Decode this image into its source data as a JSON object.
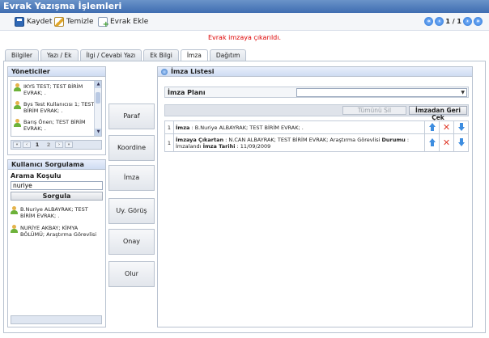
{
  "app": {
    "title": "Evrak Yazışma İşlemleri"
  },
  "toolbar": {
    "save_label": "Kaydet",
    "clear_label": "Temizle",
    "add_label": "Evrak Ekle",
    "page_indicator": "1 / 1"
  },
  "message": "Evrak imzaya çıkarıldı.",
  "tabs": [
    {
      "label": "Bilgiler"
    },
    {
      "label": "Yazı / Ek"
    },
    {
      "label": "İlgi / Cevabi Yazı"
    },
    {
      "label": "Ek Bilgi"
    },
    {
      "label": "İmza"
    },
    {
      "label": "Dağıtım"
    }
  ],
  "active_tab": "İmza",
  "managers": {
    "title": "Yöneticiler",
    "items": [
      {
        "label": "IKYS TEST; TEST BİRİM EVRAK; ."
      },
      {
        "label": "Bys Test Kullanıcısı 1; TEST BİRİM EVRAK; ."
      },
      {
        "label": "Barış Önen; TEST BİRİM EVRAK; ."
      }
    ],
    "pager": {
      "current": "1",
      "next": "2"
    }
  },
  "user_search": {
    "title": "Kullanıcı Sorgulama",
    "label": "Arama Koşulu",
    "value": "nuriye",
    "button": "Sorgula",
    "results": [
      {
        "label": "B.Nuriye ALBAYRAK; TEST BİRİM EVRAK; ."
      },
      {
        "label": "NURİYE AKBAY; KİMYA BÖLÜMÜ; Araştırma Görevlisi"
      }
    ]
  },
  "actions": [
    {
      "label": "Paraf"
    },
    {
      "label": "Koordine"
    },
    {
      "label": "İmza"
    },
    {
      "label": "Uy. Görüş"
    },
    {
      "label": "Onay"
    },
    {
      "label": "Olur"
    }
  ],
  "signature_list": {
    "title": "İmza Listesi",
    "plan_label": "İmza Planı",
    "plan_value": "",
    "clear_all": "Tümünü Sil",
    "recall": "İmzadan Geri Çek",
    "rows": [
      {
        "num": "1",
        "type_label": "İmza",
        "text": "B.Nuriye ALBAYRAK; TEST BİRİM EVRAK; ."
      },
      {
        "num": "1",
        "type_label": "İmzaya Çıkartan",
        "text": "N.CAN ALBAYRAK; TEST BİRİM EVRAK; Araştırma Görevlisi",
        "status_label": "Durumu",
        "status": "İmzalandı",
        "date_label": "İmza Tarihi",
        "date": "11/09/2009"
      }
    ]
  },
  "colors": {
    "title_bar": "#4a78bd",
    "message": "#dd0000",
    "delete": "#e03b2b",
    "arrow": "#3d8de0"
  }
}
